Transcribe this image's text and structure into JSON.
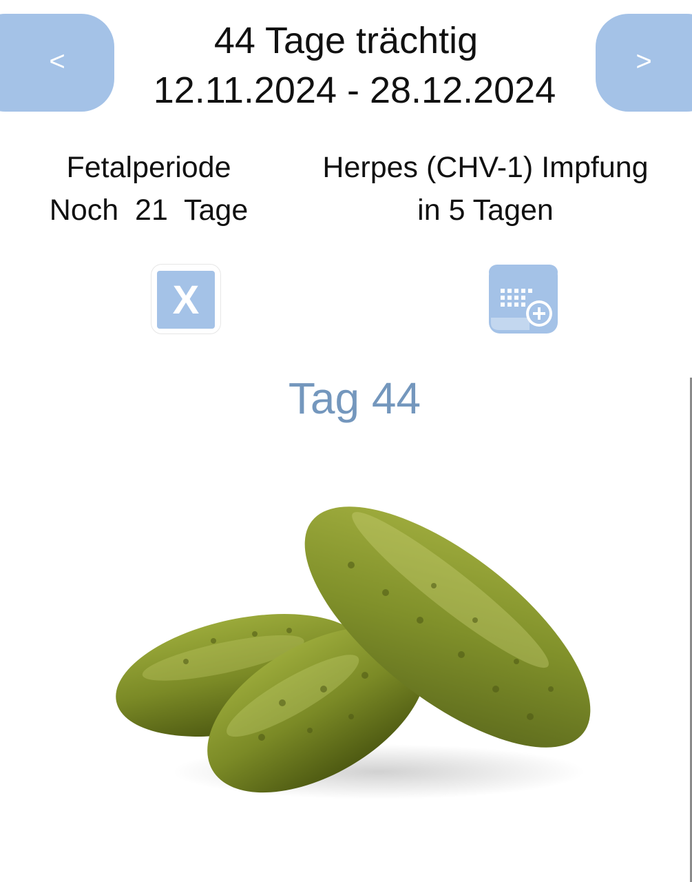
{
  "header": {
    "title": "44 Tage trächtig",
    "date_range": "12.11.2024 - 28.12.2024",
    "prev_label": "<",
    "next_label": ">"
  },
  "info": {
    "period_name": "Fetalperiode",
    "period_remaining": "Noch  21  Tage",
    "event_name": "Herpes (CHV-1) Impfung",
    "event_due": "in 5 Tagen"
  },
  "actions": {
    "close_label": "X",
    "calendar_icon": "calendar-add-icon"
  },
  "day": {
    "title": "Tag 44"
  },
  "image": {
    "subject": "pickles-image"
  },
  "colors": {
    "accent": "#a4c2e7",
    "day_title": "#7497bd"
  }
}
